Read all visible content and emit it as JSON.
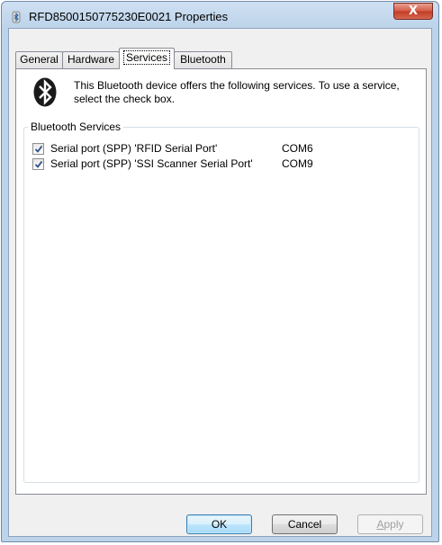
{
  "window": {
    "title": "RFD8500150775230E0021 Properties",
    "close_label": "X"
  },
  "tabs": [
    {
      "label": "General",
      "active": false
    },
    {
      "label": "Hardware",
      "active": false
    },
    {
      "label": "Services",
      "active": true
    },
    {
      "label": "Bluetooth",
      "active": false
    }
  ],
  "services_panel": {
    "description": "This Bluetooth device offers the following services. To use a service, select the check box.",
    "group_label": "Bluetooth Services",
    "services": [
      {
        "name": "Serial port (SPP) 'RFID Serial Port'",
        "port": "COM6",
        "checked": true
      },
      {
        "name": "Serial port (SPP) 'SSI Scanner Serial Port'",
        "port": "COM9",
        "checked": true
      }
    ]
  },
  "buttons": {
    "ok": "OK",
    "cancel": "Cancel",
    "apply_first": "A",
    "apply_rest": "pply"
  },
  "colors": {
    "bluetooth_badge": "#1a1a1a",
    "close_button": "#c94a35",
    "default_button_border": "#3c7fb1"
  },
  "icons": {
    "title": "bluetooth-device-icon",
    "panel": "bluetooth-icon"
  }
}
